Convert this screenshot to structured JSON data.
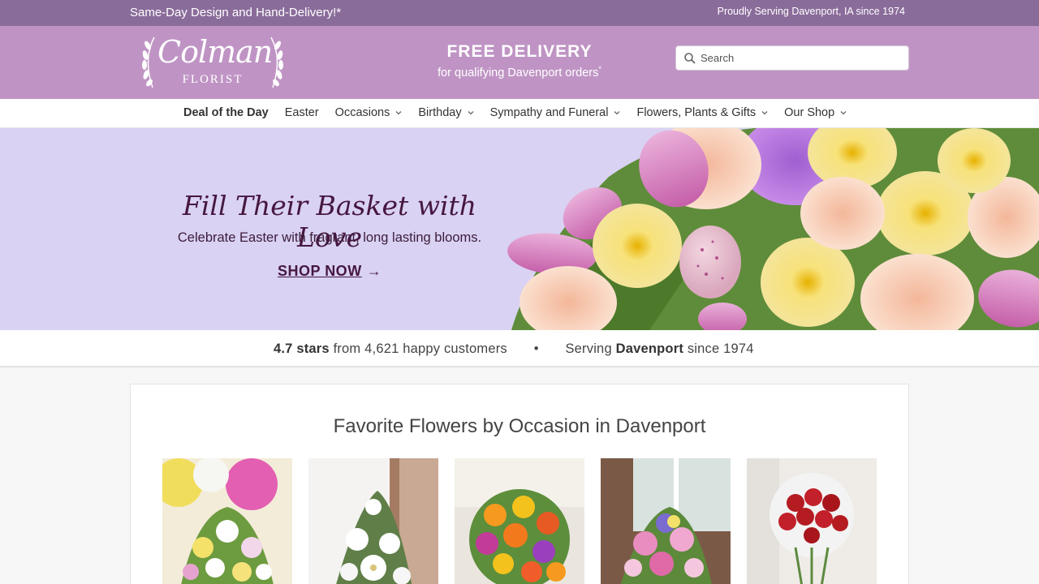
{
  "topbar": {
    "left_text": "Same-Day Design and Hand-Delivery!*",
    "right_text": "Proudly Serving Davenport, IA since 1974"
  },
  "logo": {
    "script": "Colman",
    "sub": "FLORIST"
  },
  "promo": {
    "headline": "FREE DELIVERY",
    "subline": "for qualifying Davenport orders",
    "asterisk": "*"
  },
  "search": {
    "placeholder": "Search",
    "value": "",
    "icon": "search-icon"
  },
  "nav": {
    "items": [
      {
        "label": "Deal of the Day",
        "bold": true,
        "dropdown": false
      },
      {
        "label": "Easter",
        "bold": false,
        "dropdown": false
      },
      {
        "label": "Occasions",
        "bold": false,
        "dropdown": true
      },
      {
        "label": "Birthday",
        "bold": false,
        "dropdown": true
      },
      {
        "label": "Sympathy and Funeral",
        "bold": false,
        "dropdown": true
      },
      {
        "label": "Flowers, Plants & Gifts",
        "bold": false,
        "dropdown": true
      },
      {
        "label": "Our Shop",
        "bold": false,
        "dropdown": true
      }
    ]
  },
  "hero": {
    "headline": "Fill Their Basket with Love",
    "subline": "Celebrate Easter with fragrant, long lasting blooms.",
    "cta": "SHOP NOW",
    "cta_icon": "arrow-right-icon"
  },
  "trust": {
    "rating": "4.7 stars",
    "reviews_text": "from 4,621 happy customers",
    "separator": "•",
    "serving_prefix": "Serving",
    "city": "Davenport",
    "since": "since 1974"
  },
  "occasions": {
    "title": "Favorite Flowers by Occasion in Davenport"
  },
  "colors": {
    "topbar": "#8a6c9a",
    "header": "#bf94c4",
    "hero_bg": "#d9d2f3",
    "hero_text": "#46173f"
  }
}
